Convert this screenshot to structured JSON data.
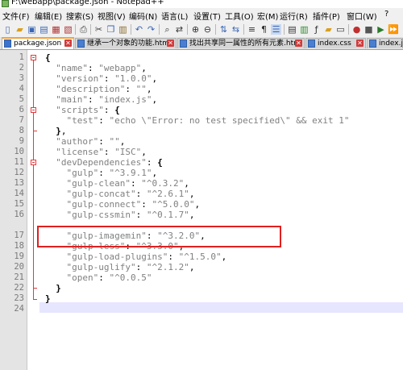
{
  "window": {
    "title": "F:\\webapp\\package.json - Notepad++"
  },
  "menu": [
    "文件(F)",
    "编辑(E)",
    "搜索(S)",
    "视图(V)",
    "编码(N)",
    "语言(L)",
    "设置(T)",
    "工具(O)",
    "宏(M)",
    "运行(R)",
    "插件(P)",
    "窗口(W)",
    "?"
  ],
  "tabs": [
    {
      "label": "package.json",
      "active": true
    },
    {
      "label": "继承一个对象的功能.html",
      "active": false
    },
    {
      "label": "找出共享同一属性的所有元素.html",
      "active": false
    },
    {
      "label": "index.css",
      "active": false
    },
    {
      "label": "index.js",
      "active": false
    }
  ],
  "editor": {
    "line_numbers": [
      "1",
      "2",
      "3",
      "4",
      "5",
      "6",
      "7",
      "8",
      "9",
      "10",
      "11",
      "12",
      "13",
      "14",
      "15",
      "16",
      "17",
      "18",
      "19",
      "20",
      "21",
      "22",
      "23",
      "24"
    ],
    "lines": [
      "{",
      "  \"name\": \"webapp\",",
      "  \"version\": \"1.0.0\",",
      "  \"description\": \"\",",
      "  \"main\": \"index.js\",",
      "  \"scripts\": {",
      "    \"test\": \"echo \\\"Error: no test specified\\\" && exit 1\"",
      "  },",
      "  \"author\": \"\",",
      "  \"license\": \"ISC\",",
      "  \"devDependencies\": {",
      "    \"gulp\": \"^3.9.1\",",
      "    \"gulp-clean\": \"^0.3.2\",",
      "    \"gulp-concat\": \"^2.6.1\",",
      "    \"gulp-connect\": \"^5.0.0\",",
      "    \"gulp-cssmin\": \"^0.1.7\",",
      "    \"gulp-imagemin\": \"^3.2.0\",",
      "    \"gulp-less\": \"^3.3.0\",",
      "    \"gulp-load-plugins\": \"^1.5.0\",",
      "    \"gulp-uglify\": \"^2.1.2\",",
      "    \"open\": \"^0.0.5\"",
      "  }",
      "}",
      ""
    ]
  },
  "colors": {
    "string": "#808080",
    "fold_marker": "#e23a3a",
    "highlight_box": "#e02020",
    "active_tab_accent": "#f2a23a"
  },
  "toolbar_icons": [
    "new-file-icon",
    "open-file-icon",
    "save-icon",
    "save-all-icon",
    "close-icon",
    "close-all-icon",
    "print-icon",
    "cut-icon",
    "copy-icon",
    "paste-icon",
    "undo-icon",
    "redo-icon",
    "find-icon",
    "replace-icon",
    "zoom-in-icon",
    "zoom-out-icon",
    "sync-v-icon",
    "sync-h-icon",
    "word-wrap-icon",
    "show-all-icon",
    "indent-guide-icon",
    "lang-icon",
    "doc-map-icon",
    "function-list-icon",
    "folder-workspace-icon",
    "monitor-icon",
    "record-icon",
    "stop-icon",
    "play-icon"
  ]
}
